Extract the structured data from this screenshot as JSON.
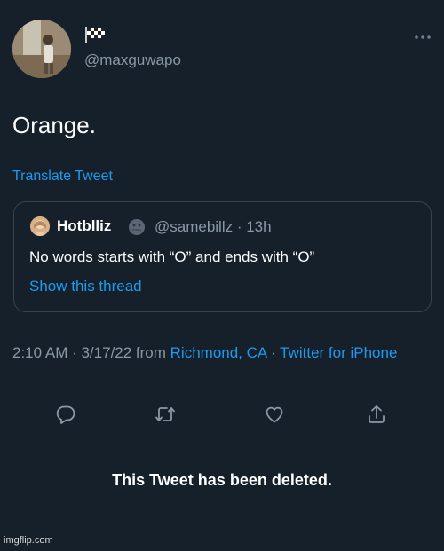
{
  "tweet": {
    "handle": "@maxguwapo",
    "display_name_icon": "checkered-flag-icon",
    "text": "Orange.",
    "translate_label": "Translate Tweet"
  },
  "quote": {
    "name": "Hotblliz",
    "name_emoji_icon": "moon-face-icon",
    "handle_time": "@samebillz · 13h",
    "text": "No words starts with “O” and ends with “O”",
    "thread_link": "Show this thread"
  },
  "timestamp": {
    "time_date": "2:10 AM · 3/17/22 from ",
    "location": "Richmond, CA",
    "separator": " · ",
    "source": "Twitter for iPhone"
  },
  "actions": {
    "reply_icon": "reply-icon",
    "retweet_icon": "retweet-icon",
    "like_icon": "like-icon",
    "share_icon": "share-icon"
  },
  "deleted_notice": "This Tweet has been deleted.",
  "watermark": "imgflip.com",
  "colors": {
    "background": "#15202b",
    "accent": "#1d9bf0",
    "secondary_text": "#8b98a5",
    "border": "#38444d"
  }
}
